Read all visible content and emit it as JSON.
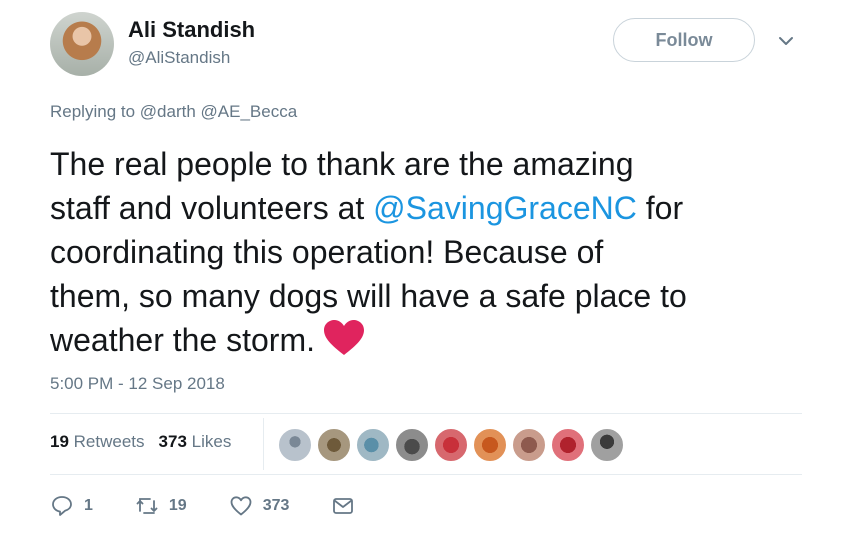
{
  "author": {
    "name": "Ali Standish",
    "handle": "@AliStandish"
  },
  "follow_label": "Follow",
  "replying": {
    "prefix": "Replying to",
    "mentions": [
      "@darth",
      "@AE_Becca"
    ]
  },
  "tweet": {
    "line1": "The real people to thank are the amazing",
    "line2_pre": "staff and volunteers at ",
    "line2_link": "@SavingGraceNC",
    "line2_post": " for",
    "line3": "coordinating this operation! Because of",
    "line4": "them, so many dogs will have a safe place to",
    "line5": "weather the storm."
  },
  "timestamp": "5:00 PM - 12 Sep 2018",
  "stats": {
    "retweets_count": "19",
    "retweets_label": "Retweets",
    "likes_count": "373",
    "likes_label": "Likes"
  },
  "actions": {
    "reply_count": "1",
    "retweet_count": "19",
    "like_count": "373"
  },
  "colors": {
    "link": "#1b95e0",
    "secondary_text": "#657786",
    "heart": "#e0245e"
  }
}
